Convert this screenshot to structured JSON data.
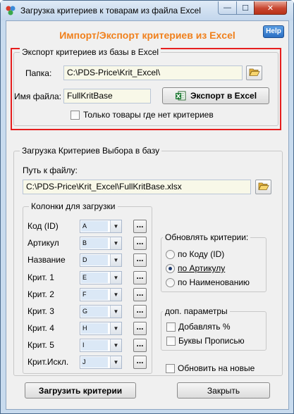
{
  "window": {
    "title": "Загрузка критериев к товарам из файла Excel",
    "minimize_glyph": "—",
    "maximize_glyph": "☐",
    "close_glyph": "✕"
  },
  "header": {
    "title": "Импорт/Экспорт критериев из Excel",
    "help_label": "Help"
  },
  "export_group": {
    "legend": "Экспорт критериев из базы в Excel",
    "folder_label": "Папка:",
    "folder_value": "C:\\PDS-Price\\Krit_Excel\\",
    "filename_label": "Имя файла:",
    "filename_value": "FullKritBase",
    "export_button": "Экспорт в Excel",
    "only_without_criteria": "Только товары где нет критериев"
  },
  "import_group": {
    "legend": "Загрузка Критериев Выбора в базу",
    "path_label": "Путь к файлу:",
    "path_value": "C:\\PDS-Price\\Krit_Excel\\FullKritBase.xlsx"
  },
  "columns_group": {
    "legend": "Колонки для загрузки",
    "dots_label": "...",
    "rows": [
      {
        "label": "Код (ID)",
        "value": "A"
      },
      {
        "label": "Артикул",
        "value": "B"
      },
      {
        "label": "Название",
        "value": "D"
      },
      {
        "label": "Крит. 1",
        "value": "E"
      },
      {
        "label": "Крит. 2",
        "value": "F"
      },
      {
        "label": "Крит. 3",
        "value": "G"
      },
      {
        "label": "Крит. 4",
        "value": "H"
      },
      {
        "label": "Крит. 5",
        "value": "I"
      },
      {
        "label": "Крит.Искл.",
        "value": "J"
      }
    ]
  },
  "update_group": {
    "legend": "Обновлять критерии:",
    "options": [
      "по Коду (ID)",
      "по Артикулу",
      "по Наименованию"
    ],
    "selected_index": 1
  },
  "extra_group": {
    "legend": "доп. параметры",
    "add_percent": "Добавлять %",
    "capital_letters": "Буквы Прописью"
  },
  "update_new": "Обновить на новые",
  "footer": {
    "load_button": "Загрузить критерии",
    "close_button": "Закрыть"
  },
  "colors": {
    "accent_orange": "#f0801c",
    "highlight_red": "#e61e1e",
    "field_bg": "#f8f8e8",
    "help_blue": "#2b6fc4"
  },
  "icons": {
    "app": "app-logo-icon",
    "folder": "folder-open-icon",
    "excel": "excel-icon"
  }
}
